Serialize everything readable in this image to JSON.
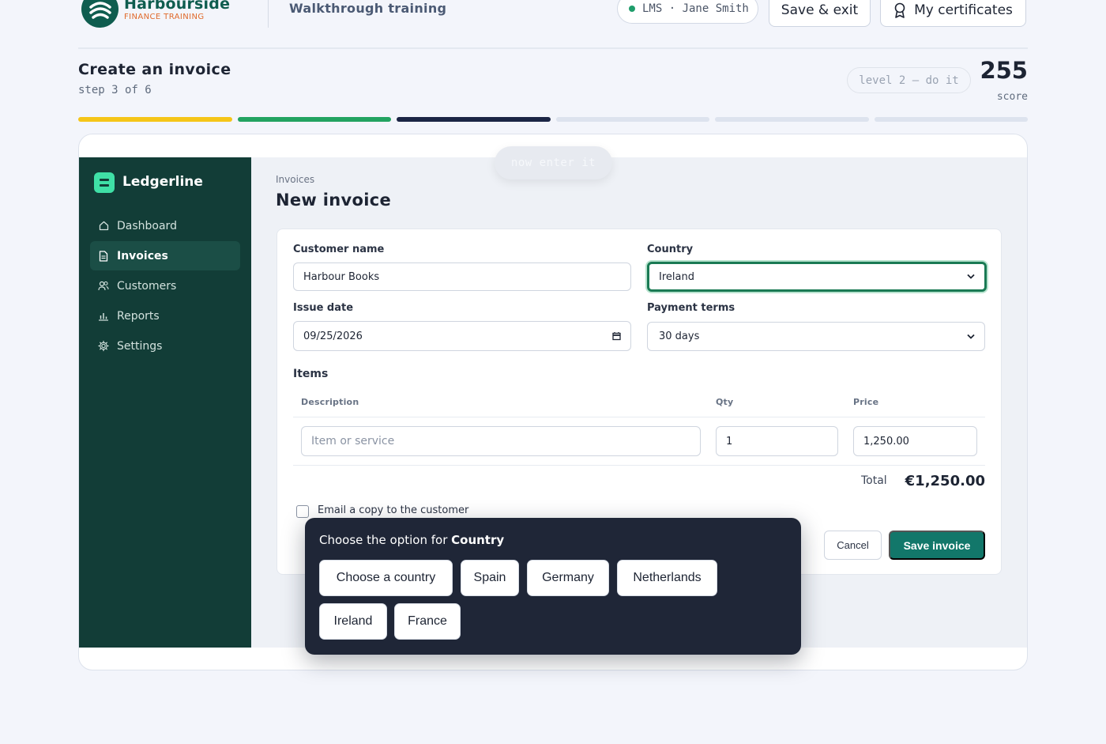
{
  "header": {
    "brand_name": "Harbourside",
    "brand_sub": "FINANCE TRAINING",
    "training_title": "Walkthrough training",
    "user_pill": "LMS · Jane Smith",
    "save_exit": "Save & exit",
    "certificates": "My certificates"
  },
  "task": {
    "title": "Create an invoice",
    "step": "step 3 of 6",
    "level": "level 2 — do it",
    "score": "255",
    "score_label": "score",
    "progress_segments": [
      {
        "state": "done",
        "color": "#f5c518"
      },
      {
        "state": "done",
        "color": "#22a361"
      },
      {
        "state": "current",
        "color": "#1b2545"
      },
      {
        "state": "todo",
        "color": "#dde3ee"
      },
      {
        "state": "todo",
        "color": "#dde3ee"
      },
      {
        "state": "todo",
        "color": "#dde3ee"
      }
    ]
  },
  "hint": "now enter it",
  "app": {
    "name": "Ledgerline",
    "nav": [
      {
        "label": "Dashboard",
        "icon": "home-icon"
      },
      {
        "label": "Invoices",
        "icon": "document-icon",
        "active": true
      },
      {
        "label": "Customers",
        "icon": "users-icon"
      },
      {
        "label": "Reports",
        "icon": "bar-chart-icon"
      },
      {
        "label": "Settings",
        "icon": "gear-icon"
      }
    ],
    "breadcrumb": "Invoices",
    "page_title": "New invoice",
    "form": {
      "customer_label": "Customer name",
      "customer_value": "Harbour Books",
      "country_label": "Country",
      "country_value": "Ireland",
      "issue_date_label": "Issue date",
      "issue_date_value": "09/25/2026",
      "terms_label": "Payment terms",
      "terms_value": "30 days",
      "items_heading": "Items",
      "col_description": "Description",
      "col_qty": "Qty",
      "col_price": "Price",
      "item_placeholder": "Item or service",
      "qty_value": "1",
      "price_value": "1,250.00",
      "total_label": "Total",
      "total_value": "€1,250.00",
      "email_copy_label": "Email a copy to the customer",
      "cancel": "Cancel",
      "save": "Save invoice"
    }
  },
  "overlay": {
    "prompt_prefix": "Choose the option for",
    "prompt_field": "Country",
    "options": [
      "Choose a country",
      "Spain",
      "Germany",
      "Netherlands",
      "Ireland",
      "France"
    ]
  },
  "colors": {
    "brand": "#0f5d4f",
    "accent_orange": "#e06a2c",
    "sidebar": "#123d37",
    "primary_button": "#12776a",
    "focus": "#1a7a54",
    "overlay": "#1f2637"
  }
}
